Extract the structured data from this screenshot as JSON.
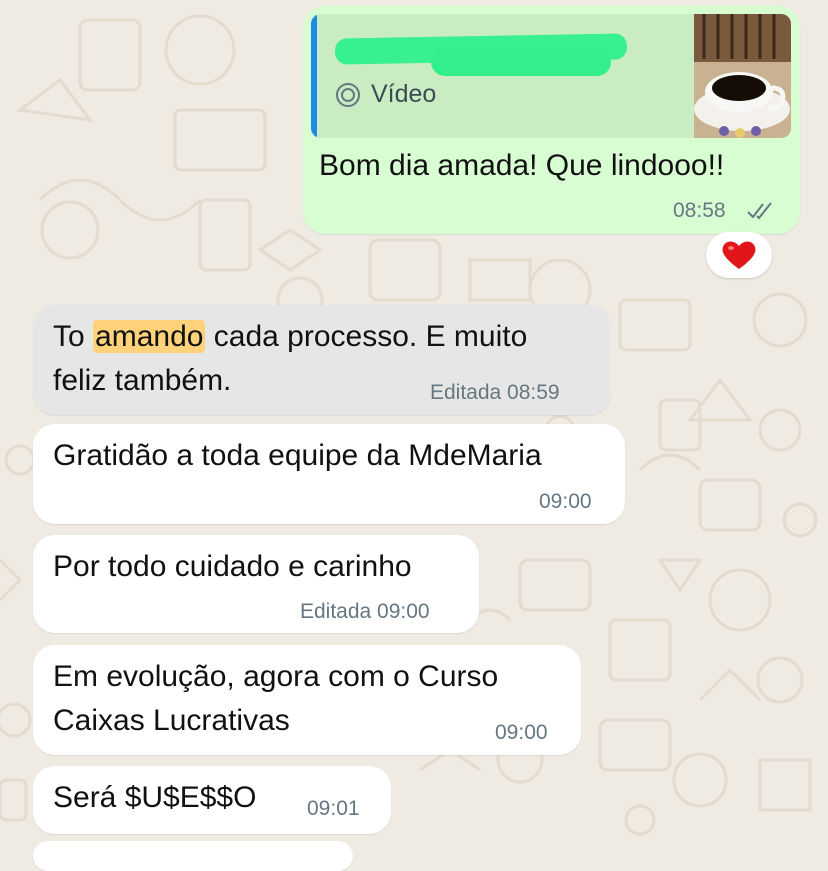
{
  "chat": {
    "messages": [
      {
        "quote": {
          "label": "Vídeo"
        },
        "text": "Bom dia amada! Que lindooo!!",
        "time": "08:58",
        "reaction": "❤️"
      },
      {
        "text_before": "To ",
        "text_highlight": "amando",
        "text_after": " cada processo. E muito",
        "text_line2": "feliz também.",
        "meta": "Editada 08:59"
      },
      {
        "text": "Gratidão a toda equipe da MdeMaria",
        "meta": "09:00"
      },
      {
        "text": "Por todo cuidado e carinho",
        "meta": "Editada 09:00"
      },
      {
        "text_line1": "Em evolução, agora com o Curso",
        "text_line2": "Caixas Lucrativas",
        "meta": "09:00"
      },
      {
        "text": "Será $U$E$$O",
        "meta": "09:01"
      }
    ]
  },
  "colors": {
    "outgoing_bubble": "#d9fdd3",
    "incoming_bubble": "#ffffff",
    "search_highlight": "#fdd27a",
    "read_ticks": "#667781"
  }
}
